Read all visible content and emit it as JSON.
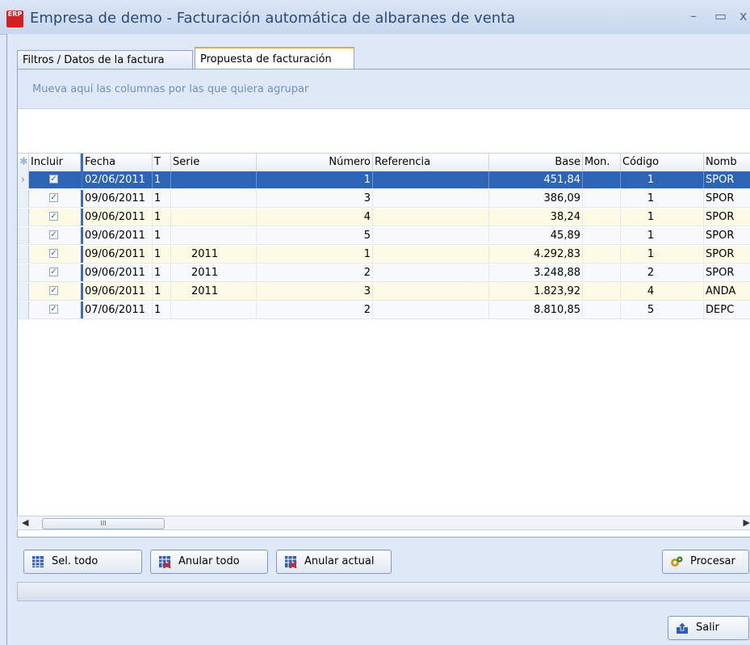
{
  "window": {
    "title": "Empresa de demo - Facturación automática de albaranes de venta"
  },
  "app_icon": {
    "text": "ERP"
  },
  "tabs": [
    {
      "label": "Filtros / Datos de la factura"
    },
    {
      "label": "Propuesta de facturación"
    }
  ],
  "group_hint": "Mueva aquí las columnas por las que quiera agrupar",
  "columns": [
    "Incluir",
    "Fecha",
    "T",
    "Serie",
    "Número",
    "Referencia",
    "Base",
    "Mon.",
    "Código",
    "Nomb"
  ],
  "rows": [
    {
      "fecha": "02/06/2011",
      "t": "1",
      "serie": "",
      "numero": "1",
      "referencia": "",
      "base": "451,84",
      "mon": "",
      "codigo": "1",
      "nombre": "SPOR"
    },
    {
      "fecha": "09/06/2011",
      "t": "1",
      "serie": "",
      "numero": "3",
      "referencia": "",
      "base": "386,09",
      "mon": "",
      "codigo": "1",
      "nombre": "SPOR"
    },
    {
      "fecha": "09/06/2011",
      "t": "1",
      "serie": "",
      "numero": "4",
      "referencia": "",
      "base": "38,24",
      "mon": "",
      "codigo": "1",
      "nombre": "SPOR"
    },
    {
      "fecha": "09/06/2011",
      "t": "1",
      "serie": "",
      "numero": "5",
      "referencia": "",
      "base": "45,89",
      "mon": "",
      "codigo": "1",
      "nombre": "SPOR"
    },
    {
      "fecha": "09/06/2011",
      "t": "1",
      "serie": "2011",
      "numero": "1",
      "referencia": "",
      "base": "4.292,83",
      "mon": "",
      "codigo": "1",
      "nombre": "SPOR"
    },
    {
      "fecha": "09/06/2011",
      "t": "1",
      "serie": "2011",
      "numero": "2",
      "referencia": "",
      "base": "3.248,88",
      "mon": "",
      "codigo": "2",
      "nombre": "SPOR"
    },
    {
      "fecha": "09/06/2011",
      "t": "1",
      "serie": "2011",
      "numero": "3",
      "referencia": "",
      "base": "1.823,92",
      "mon": "",
      "codigo": "4",
      "nombre": "ANDA"
    },
    {
      "fecha": "07/06/2011",
      "t": "1",
      "serie": "",
      "numero": "2",
      "referencia": "",
      "base": "8.810,85",
      "mon": "",
      "codigo": "5",
      "nombre": "DEPC"
    }
  ],
  "buttons": {
    "sel_todo": "Sel. todo",
    "anular_todo": "Anular todo",
    "anular_actual": "Anular actual",
    "procesar": "Procesar",
    "salir": "Salir"
  },
  "scroll": {
    "thumb_glyph": "III"
  }
}
